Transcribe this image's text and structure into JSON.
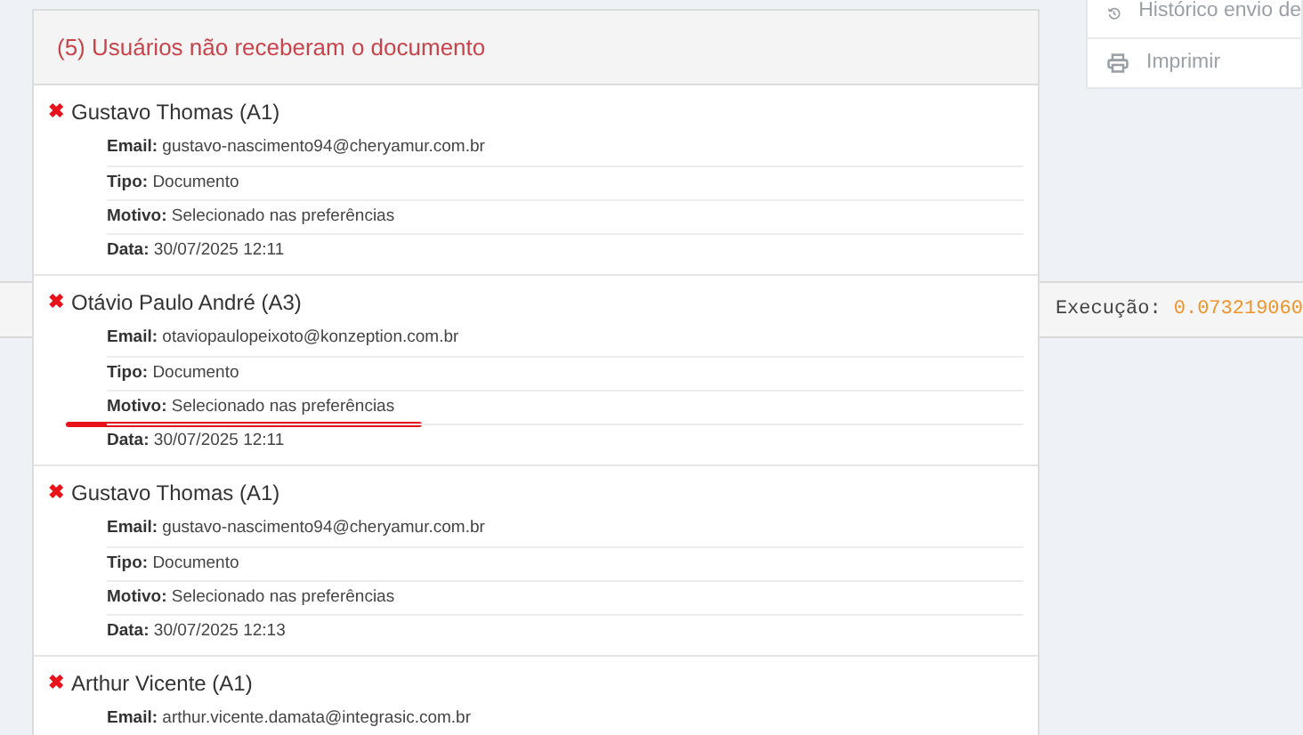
{
  "side_menu": {
    "items": [
      {
        "label": "Histórico envio de",
        "kind": "history"
      },
      {
        "label": "Imprimir",
        "kind": "print"
      }
    ]
  },
  "footer": {
    "label": "Execução:",
    "value": "0.073219060"
  },
  "modal": {
    "title": "(5) Usuários não receberam o documento",
    "users": [
      {
        "status_icon": "✖",
        "name": "Gustavo Thomas (A1)",
        "fields": [
          {
            "label": "Email:",
            "value": "gustavo-nascimento94@cheryamur.com.br",
            "marked": false
          },
          {
            "label": "Tipo:",
            "value": "Documento",
            "marked": false
          },
          {
            "label": "Motivo:",
            "value": "Selecionado nas preferências",
            "marked": false
          },
          {
            "label": "Data:",
            "value": "30/07/2025 12:11",
            "marked": false
          }
        ]
      },
      {
        "status_icon": "✖",
        "name": "Otávio Paulo André (A3)",
        "fields": [
          {
            "label": "Email:",
            "value": "otaviopaulopeixoto@konzeption.com.br",
            "marked": false
          },
          {
            "label": "Tipo:",
            "value": "Documento",
            "marked": false
          },
          {
            "label": "Motivo:",
            "value": "Selecionado nas preferências",
            "marked": true
          },
          {
            "label": "Data:",
            "value": "30/07/2025 12:11",
            "marked": false
          }
        ]
      },
      {
        "status_icon": "✖",
        "name": "Gustavo Thomas (A1)",
        "fields": [
          {
            "label": "Email:",
            "value": "gustavo-nascimento94@cheryamur.com.br",
            "marked": false
          },
          {
            "label": "Tipo:",
            "value": "Documento",
            "marked": false
          },
          {
            "label": "Motivo:",
            "value": "Selecionado nas preferências",
            "marked": false
          },
          {
            "label": "Data:",
            "value": "30/07/2025 12:13",
            "marked": false
          }
        ]
      },
      {
        "status_icon": "✖",
        "name": "Arthur Vicente (A1)",
        "fields": [
          {
            "label": "Email:",
            "value": "arthur.vicente.damata@integrasic.com.br"
          }
        ]
      }
    ]
  }
}
